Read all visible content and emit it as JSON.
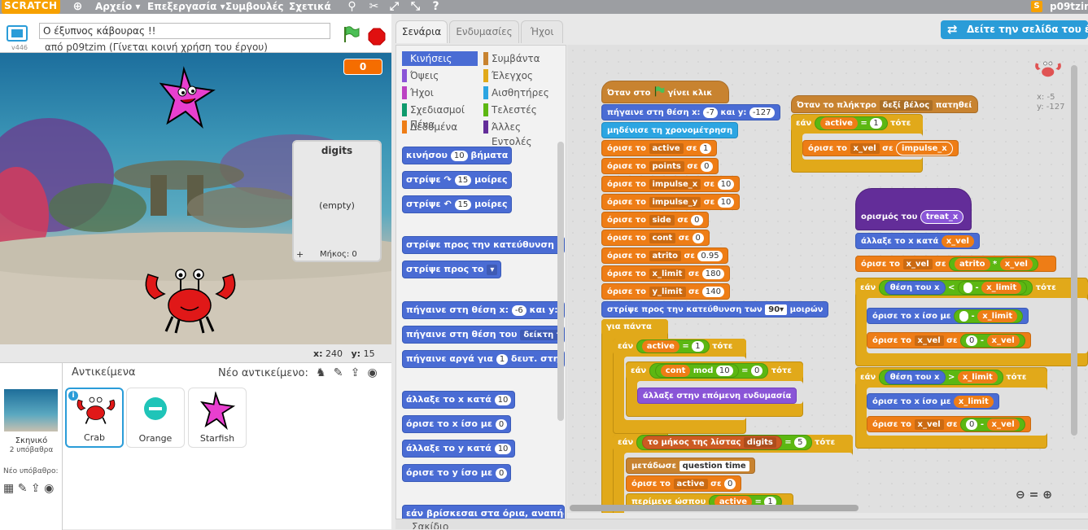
{
  "menu": {
    "logo": "SCRATCH",
    "items": [
      "Αρχείο ▾",
      "Επεξεργασία ▾",
      "Συμβουλές",
      "Σχετικά"
    ],
    "username": "p09tzim"
  },
  "project": {
    "title": "Ο έξυπνος κάβουρας !!",
    "byline": "από p09tzim (Γίνεται κοινή χρήση του έργου)",
    "version": "v446"
  },
  "stage": {
    "score": "0",
    "list_monitor": {
      "title": "digits",
      "empty": "(empty)",
      "length_label": "Μήκος: 0",
      "plus": "+"
    },
    "coords": {
      "x_label": "x:",
      "x": "240",
      "y_label": "y:",
      "y": "15"
    }
  },
  "sprites_panel": {
    "label": "Αντικείμενα",
    "new_object": "Νέο αντικείμενο:",
    "stage_name": "Σκηνικό",
    "stage_backdrops": "2 υπόβαθρα",
    "new_backdrop": "Νέο υπόβαθρο:",
    "sprites": [
      {
        "name": "Crab",
        "selected": true
      },
      {
        "name": "Orange",
        "selected": false
      },
      {
        "name": "Starfish",
        "selected": false
      }
    ]
  },
  "tabs": [
    "Σενάρια",
    "Ενδυμασίες",
    "Ήχοι"
  ],
  "see_project_page": "Δείτε την σελίδα του έργου",
  "categories": [
    {
      "label": "Κινήσεις",
      "color": "#4a6cd4",
      "selected": true
    },
    {
      "label": "Συμβάντα",
      "color": "#c88330"
    },
    {
      "label": "Όψεις",
      "color": "#8a55d7"
    },
    {
      "label": "Έλεγχος",
      "color": "#e1a91a"
    },
    {
      "label": "Ήχοι",
      "color": "#bb42c3"
    },
    {
      "label": "Αισθητήρες",
      "color": "#2ca5e2"
    },
    {
      "label": "Σχεδιασμοί Πένα",
      "color": "#0e9a6c"
    },
    {
      "label": "Τελεστές",
      "color": "#5cb712"
    },
    {
      "label": "Δεδομένα",
      "color": "#ee7d16"
    },
    {
      "label": "Άλλες Εντολές",
      "color": "#632d99"
    }
  ],
  "palette_blocks": {
    "move": {
      "a": "κινήσου",
      "v": "10",
      "b": "βήματα"
    },
    "turn_r": {
      "a": "στρίψε",
      "icon": "↷",
      "v": "15",
      "b": "μοίρες"
    },
    "turn_l": {
      "a": "στρίψε",
      "icon": "↶",
      "v": "15",
      "b": "μοίρες"
    },
    "point_dir": "στρίψε προς την κατεύθυνση τα",
    "point_to": "στρίψε προς το",
    "goto_xy": {
      "a": "πήγαινε στη θέση x:",
      "x": "-6",
      "b": "και y:"
    },
    "goto_obj": {
      "a": "πήγαινε στη θέση του",
      "v": "δείκτη του"
    },
    "glide": {
      "a": "πήγαινε αργά για",
      "v": "1",
      "b": "δευτ. στη"
    },
    "change_x": {
      "a": "άλλαξε το x κατά",
      "v": "10"
    },
    "set_x": {
      "a": "όρισε το x ίσο με",
      "v": "0"
    },
    "change_y": {
      "a": "άλλαξε το y κατά",
      "v": "10"
    },
    "set_y": {
      "a": "όρισε το y ίσο με",
      "v": "0"
    },
    "bounce": "εάν βρίσκεσαι στα όρια, αναπήδα"
  },
  "scripts": {
    "main": {
      "hat": {
        "a": "Όταν στο",
        "b": "γίνει κλικ"
      },
      "goto": {
        "a": "πήγαινε στη θέση x:",
        "x": "-7",
        "b": "και y:",
        "y": "-127"
      },
      "reset_timer": "μηδένισε τη χρονομέτρηση",
      "set_label": "όρισε το",
      "to_label": "σε",
      "sets": [
        {
          "var": "active",
          "val": "1"
        },
        {
          "var": "points",
          "val": "0"
        },
        {
          "var": "impulse_x",
          "val": "10"
        },
        {
          "var": "impulse_y",
          "val": "10"
        },
        {
          "var": "side",
          "val": "0"
        },
        {
          "var": "cont",
          "val": "0"
        },
        {
          "var": "atrito",
          "val": "0.95"
        },
        {
          "var": "x_limit",
          "val": "180"
        },
        {
          "var": "y_limit",
          "val": "140"
        }
      ],
      "point_dir": {
        "a": "στρίψε προς την κατεύθυνση των",
        "v": "90▾",
        "b": "μοιρών"
      },
      "forever": "για πάντα",
      "if_label": "εάν",
      "then_label": "τότε",
      "if1_var": "active",
      "if1_val": "1",
      "if2": {
        "a": "cont",
        "op": "mod",
        "b": "10",
        "c": "0"
      },
      "next_costume": "άλλαξε στην επόμενη ενδυμασία",
      "if3": {
        "a": "το μήκος της λίστας",
        "list": "digits",
        "val": "5"
      },
      "broadcast": {
        "a": "μετάδωσε",
        "msg": "question time"
      },
      "set_active0": {
        "var": "active",
        "val": "0"
      },
      "bottom_partial": {
        "a": "περίμενε ώσπου",
        "var": "active",
        "val": "1"
      }
    },
    "key": {
      "hat": {
        "a": "Όταν το πλήκτρο",
        "key": "δεξί βέλος",
        "b": "πατηθεί"
      },
      "if_var": "active",
      "if_val": "1",
      "set": {
        "var": "x_vel",
        "val": "impulse_x"
      }
    },
    "define": {
      "hat": {
        "a": "ορισμός του",
        "name": "treat_x"
      },
      "change_x": {
        "a": "άλλαξε το x κατά",
        "v": "x_vel"
      },
      "set_mul": {
        "var": "x_vel",
        "a": "atrito",
        "op": "*",
        "b": "x_vel"
      },
      "if1": {
        "a": "θέση του x",
        "op": "<",
        "b": "x_limit"
      },
      "setx1": {
        "a": "όρισε το x ίσο με",
        "v": "x_limit"
      },
      "set_neg1": {
        "var": "x_vel",
        "a": "0",
        "op": "-",
        "b": "x_vel"
      },
      "if2": {
        "a": "θέση του x",
        "op": ">",
        "b": "x_limit"
      },
      "setx2": {
        "a": "όρισε το x ίσο με",
        "v": "x_limit"
      },
      "set_neg2": {
        "var": "x_vel",
        "a": "0",
        "op": "-",
        "b": "x_vel"
      }
    },
    "xy": {
      "x": "x: -5",
      "y": "y: -127"
    }
  },
  "backpack": "Σακίδιο"
}
